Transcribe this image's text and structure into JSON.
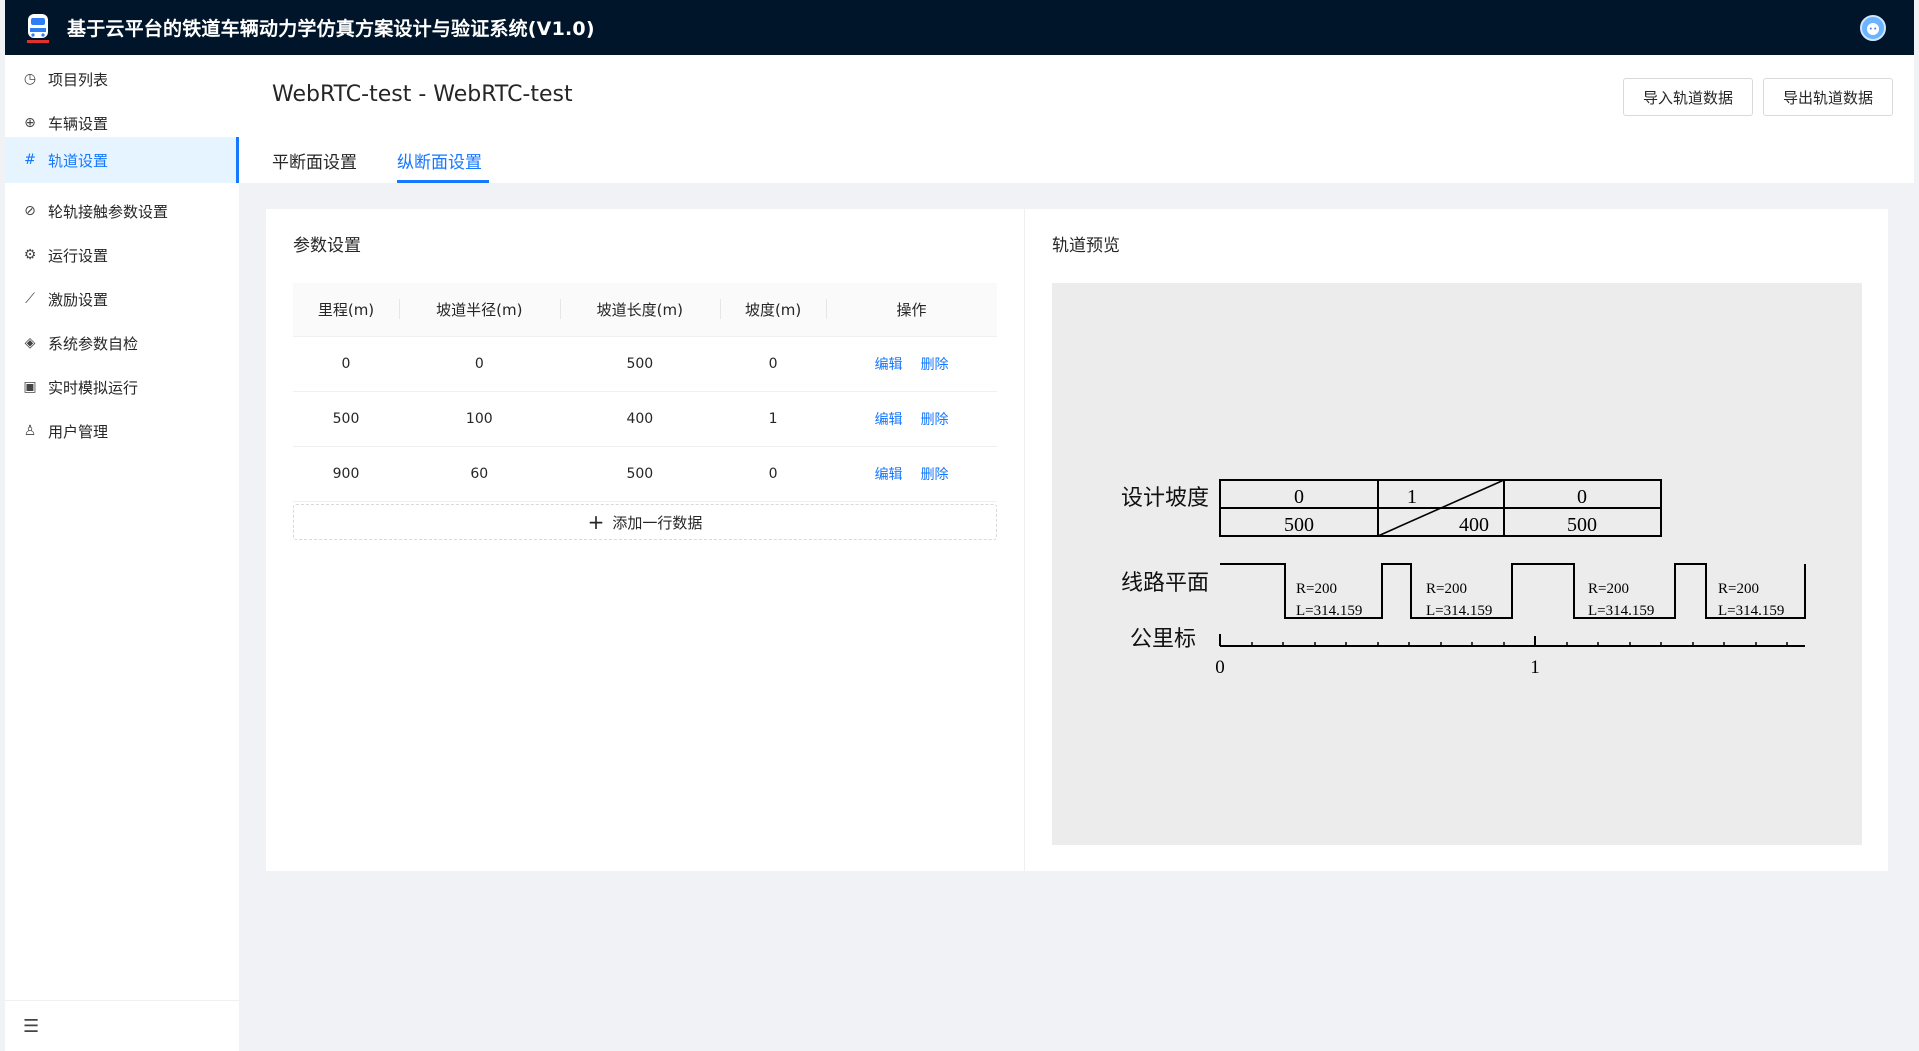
{
  "app": {
    "title": "基于云平台的铁道车辆动力学仿真方案设计与验证系统(V1.0)"
  },
  "sidebar": {
    "items": [
      {
        "label": "项目列表",
        "icon": "dashboard-icon"
      },
      {
        "label": "车辆设置",
        "icon": "globe-icon"
      },
      {
        "label": "轨道设置",
        "icon": "hash-icon",
        "active": true
      },
      {
        "label": "轮轨接触参数设置",
        "icon": "link-icon"
      },
      {
        "label": "运行设置",
        "icon": "gear-icon"
      },
      {
        "label": "激励设置",
        "icon": "line-chart-icon"
      },
      {
        "label": "系统参数自检",
        "icon": "shield-check-icon"
      },
      {
        "label": "实时模拟运行",
        "icon": "calculator-icon"
      },
      {
        "label": "用户管理",
        "icon": "user-icon"
      }
    ],
    "collapse_icon": "menu-fold-icon"
  },
  "page": {
    "title": "WebRTC-test - WebRTC-test",
    "import_label": "导入轨道数据",
    "export_label": "导出轨道数据",
    "tabs": [
      {
        "label": "平断面设置",
        "active": false
      },
      {
        "label": "纵断面设置",
        "active": true
      }
    ]
  },
  "params": {
    "title": "参数设置",
    "columns": [
      "里程(m)",
      "坡道半径(m)",
      "坡道长度(m)",
      "坡度(m)",
      "操作"
    ],
    "rows": [
      {
        "mileage": "0",
        "radius": "0",
        "length": "500",
        "slope": "0"
      },
      {
        "mileage": "500",
        "radius": "100",
        "length": "400",
        "slope": "1"
      },
      {
        "mileage": "900",
        "radius": "60",
        "length": "500",
        "slope": "0"
      }
    ],
    "edit_label": "编辑",
    "delete_label": "删除",
    "add_label": "添加一行数据"
  },
  "preview": {
    "title": "轨道预览",
    "slope_label": "设计坡度",
    "plane_label": "线路平面",
    "km_label": "公里标",
    "slope_segments": [
      {
        "grade": "0",
        "length": "500"
      },
      {
        "grade": "1",
        "length": "400"
      },
      {
        "grade": "0",
        "length": "500"
      }
    ],
    "curves": [
      {
        "r": "R=200",
        "l": "L=314.159"
      },
      {
        "r": "R=200",
        "l": "L=314.159"
      },
      {
        "r": "R=200",
        "l": "L=314.159"
      },
      {
        "r": "R=200",
        "l": "L=314.159"
      }
    ],
    "km_ticks": [
      "0",
      "1"
    ]
  },
  "colors": {
    "header_bg": "#001529",
    "accent": "#1677ff",
    "page_bg": "#f0f2f5"
  }
}
